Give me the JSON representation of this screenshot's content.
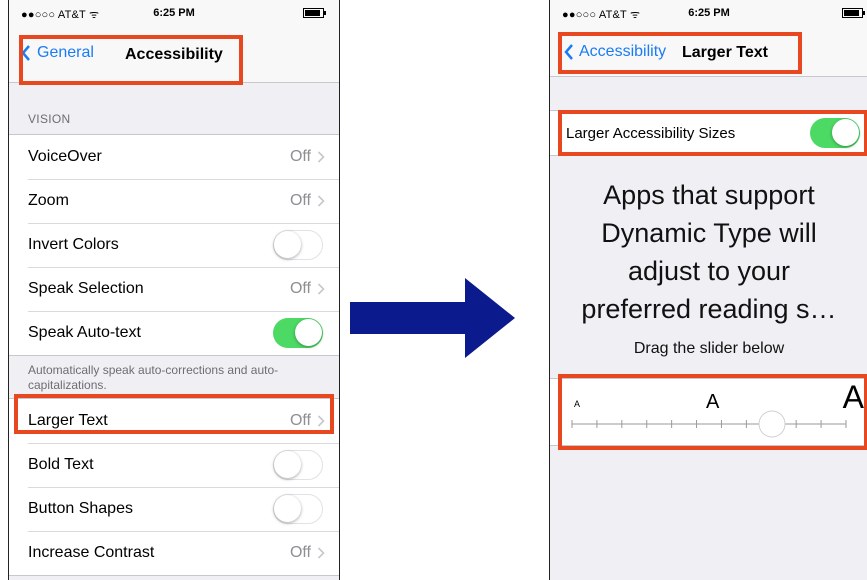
{
  "left_screen": {
    "status": {
      "carrier": "●●○○○ AT&T ᯤ",
      "time": "6:25 PM",
      "bluetooth": "✱"
    },
    "nav": {
      "back": "General",
      "title": "Accessibility"
    },
    "section_header": "VISION",
    "rows_group1": [
      {
        "label": "VoiceOver",
        "value": "Off",
        "control": "chevron"
      },
      {
        "label": "Zoom",
        "value": "Off",
        "control": "chevron"
      },
      {
        "label": "Invert Colors",
        "control": "toggle",
        "on": false
      },
      {
        "label": "Speak Selection",
        "value": "Off",
        "control": "chevron"
      },
      {
        "label": "Speak Auto-text",
        "control": "toggle",
        "on": true
      }
    ],
    "footnote": "Automatically speak auto-corrections and auto-capitalizations.",
    "rows_group2": [
      {
        "label": "Larger Text",
        "value": "Off",
        "control": "chevron"
      },
      {
        "label": "Bold Text",
        "control": "toggle",
        "on": false
      },
      {
        "label": "Button Shapes",
        "control": "toggle",
        "on": false
      },
      {
        "label": "Increase Contrast",
        "value": "Off",
        "control": "chevron"
      }
    ]
  },
  "right_screen": {
    "status": {
      "carrier": "●●○○○ AT&T ᯤ",
      "time": "6:25 PM",
      "bluetooth": "✱"
    },
    "nav": {
      "back": "Accessibility",
      "title": "Larger Text"
    },
    "toggle_row": {
      "label": "Larger Accessibility Sizes",
      "on": true
    },
    "big_text": [
      "Apps that support",
      "Dynamic Type will",
      "adjust to your",
      "preferred reading s…"
    ],
    "drag_hint": "Drag the slider below",
    "slider": {
      "small_label": "A",
      "mid_label": "A",
      "large_label": "A",
      "ticks": 12,
      "position_fraction": 0.73
    }
  },
  "colors": {
    "highlight": "#e8481f",
    "ios_blue": "#1a7cf5",
    "ios_green": "#4cd964",
    "arrow": "#0b1a8c"
  }
}
